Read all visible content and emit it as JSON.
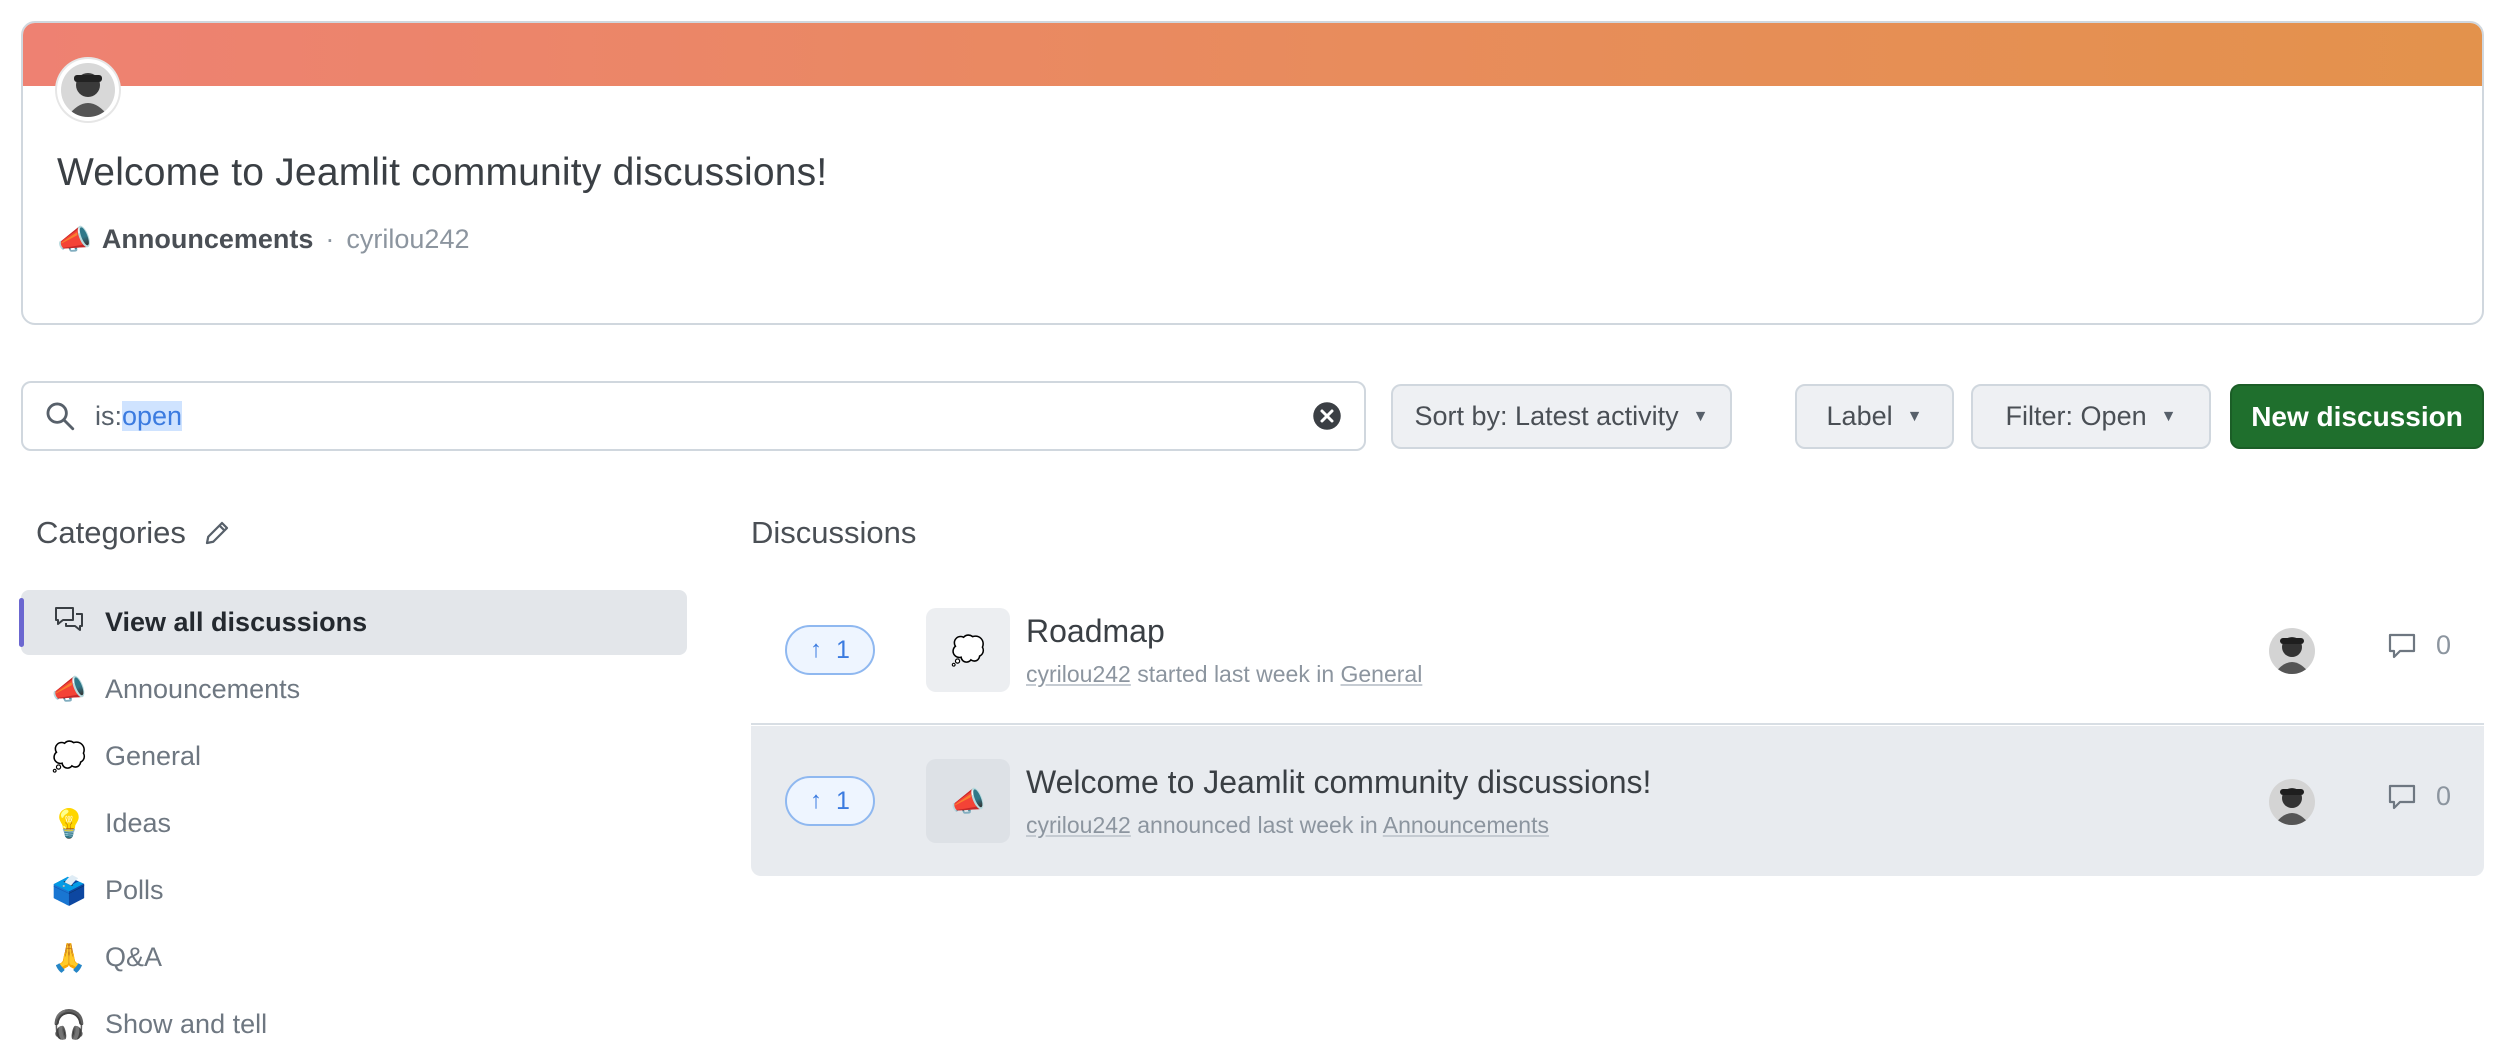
{
  "spotlight": {
    "title": "Welcome to Jeamlit community discussions!",
    "category_emoji": "📣",
    "category": "Announcements",
    "separator": "·",
    "author": "cyrilou242",
    "band_colors": [
      "#ee8172",
      "#e3924c"
    ]
  },
  "search": {
    "prefix": "is:",
    "highlighted": "open"
  },
  "toolbar": {
    "sort_label": "Sort by: Latest activity",
    "label_label": "Label",
    "filter_label": "Filter: Open",
    "new_label": "New discussion"
  },
  "sidebar": {
    "heading": "Categories",
    "items": [
      {
        "icon": "💬",
        "label": "View all discussions",
        "active": true
      },
      {
        "icon": "📣",
        "label": "Announcements"
      },
      {
        "icon": "💭",
        "label": "General"
      },
      {
        "icon": "💡",
        "label": "Ideas"
      },
      {
        "icon": "🗳️",
        "label": "Polls"
      },
      {
        "icon": "🙏",
        "label": "Q&A"
      },
      {
        "icon": "🎧",
        "label": "Show and tell"
      }
    ]
  },
  "discussions": {
    "heading": "Discussions",
    "items": [
      {
        "votes": "1",
        "icon": "💭",
        "title": "Roadmap",
        "author": "cyrilou242",
        "verb": " started last week in ",
        "category": "General",
        "comments": "0"
      },
      {
        "votes": "1",
        "icon": "📣",
        "title": "Welcome to Jeamlit community discussions!",
        "author": "cyrilou242",
        "verb": " announced last week in ",
        "category": "Announcements",
        "comments": "0"
      }
    ]
  },
  "colors": {
    "accent_green": "#1f6f2d",
    "vote_blue": "#3b7be0",
    "active_marker": "#6b67d0"
  }
}
